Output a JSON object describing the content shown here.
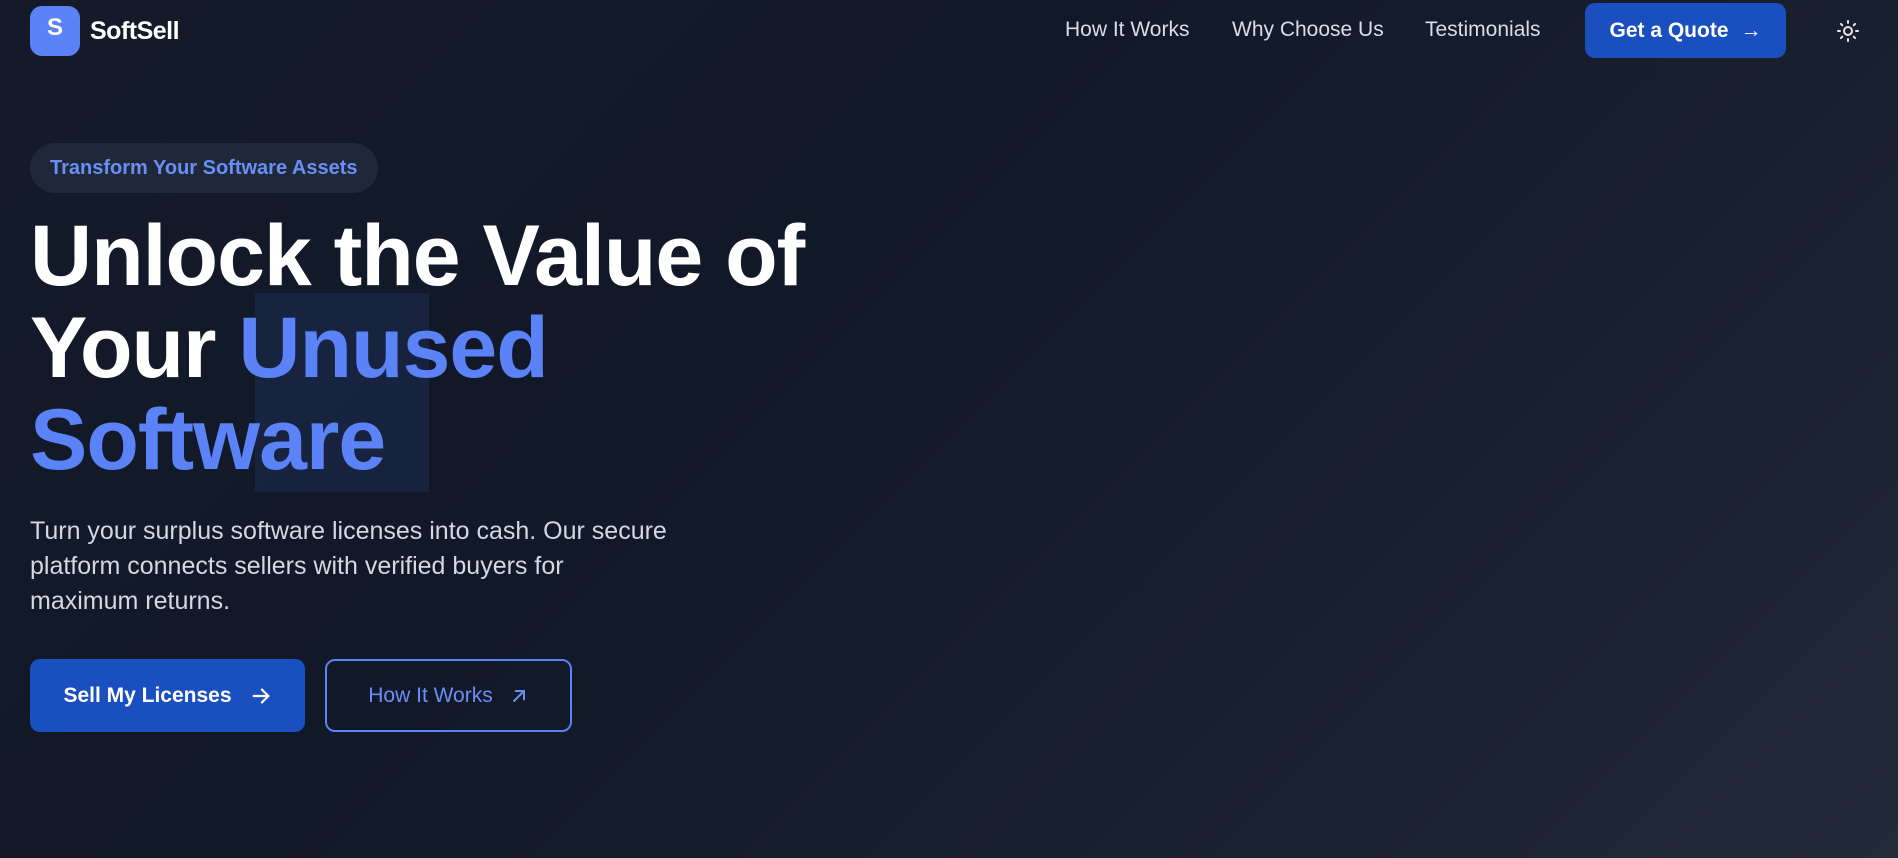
{
  "brand": {
    "logo_letter": "S",
    "name": "SoftSell",
    "accent_color": "#5b82f6",
    "primary_button_color": "#1a4fbf"
  },
  "nav": {
    "links": [
      "How It Works",
      "Why Choose Us",
      "Testimonials"
    ],
    "cta_label": "Get a Quote",
    "cta_arrow": "→",
    "theme_toggle_icon": "sun-icon"
  },
  "hero": {
    "badge": "Transform Your Software Assets",
    "headline_line1": "Unlock the Value of",
    "headline_line2_plain": "Your ",
    "headline_line2_accent": "Unused",
    "headline_line3_accent": "Software",
    "subtext": "Turn your surplus software licenses into cash. Our secure platform connects sellers with verified buyers for maximum returns.",
    "primary_button": "Sell My Licenses",
    "primary_button_icon": "arrow-right-icon",
    "secondary_button": "How It Works",
    "secondary_button_icon": "arrow-up-right-icon"
  }
}
